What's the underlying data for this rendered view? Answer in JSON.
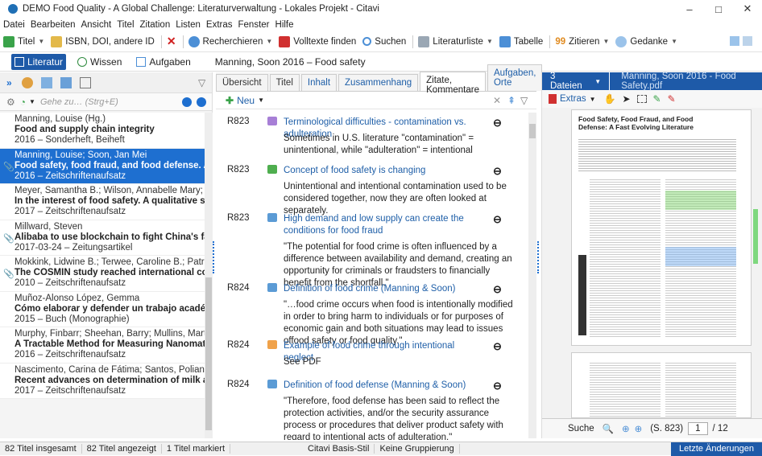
{
  "window": {
    "title": "DEMO Food Quality - A Global Challenge: Literaturverwaltung - Lokales Projekt - Citavi",
    "minimize": "–",
    "maximize": "□",
    "close": "✕"
  },
  "menu": [
    "Datei",
    "Bearbeiten",
    "Ansicht",
    "Titel",
    "Zitation",
    "Listen",
    "Extras",
    "Fenster",
    "Hilfe"
  ],
  "toolbar": {
    "titel": "Titel",
    "isbn": "ISBN, DOI, andere ID",
    "recherchieren": "Recherchieren",
    "volltexte": "Volltexte finden",
    "suchen": "Suchen",
    "literaturliste": "Literaturliste",
    "tabelle": "Tabelle",
    "zitieren": "Zitieren",
    "gedanke": "Gedanke"
  },
  "nav": {
    "tabs": [
      "Literatur",
      "Wissen",
      "Aufgaben"
    ],
    "current_title": "Manning, Soon 2016 – Food safety"
  },
  "left": {
    "search_placeholder": "Gehe zu… (Strg+E)",
    "items": [
      {
        "author": "Manning, Louise (Hg.)",
        "title": "Food and supply chain integrity",
        "year": "2016 – Sonderheft, Beiheft",
        "clip": ""
      },
      {
        "author": "Manning, Louise; Soon, Jan Mei",
        "title": "Food safety, food fraud, and food defense. A fast ev",
        "year": "2016 – Zeitschriftenaufsatz",
        "clip": "📎"
      },
      {
        "author": "Meyer, Samantha B.; Wilson, Annabelle Mary; Calnan",
        "title": "In the interest of food safety. A qualitative study in",
        "year": "2017 – Zeitschriftenaufsatz",
        "clip": ""
      },
      {
        "author": "Millward, Steven",
        "title": "Alibaba to use blockchain to fight China's fake food",
        "year": "2017-03-24 – Zeitungsartikel",
        "clip": "📎"
      },
      {
        "author": "Mokkink, Lidwine B.; Terwee, Caroline B.; Patrick, Do",
        "title": "The COSMIN study reached international consensu",
        "year": "2010 – Zeitschriftenaufsatz",
        "clip": "📎"
      },
      {
        "author": "Muñoz-Alonso López, Gemma",
        "title": "Cómo elaborar y defender un trabajo académico e",
        "year": "2015 – Buch (Monographie)",
        "clip": ""
      },
      {
        "author": "Murphy, Finbarr; Sheehan, Barry; Mullins, Martin; Bo",
        "title": "A Tractable Method for Measuring Nanomaterial Ri",
        "year": "2016 – Zeitschriftenaufsatz",
        "clip": ""
      },
      {
        "author": "Nascimento, Carina de Fátima; Santos, Poliana Mace",
        "title": "Recent advances on determination of milk adultera",
        "year": "2017 – Zeitschriftenaufsatz",
        "clip": ""
      }
    ]
  },
  "center": {
    "tabs": [
      "Übersicht",
      "Titel",
      "Inhalt",
      "Zusammenhang",
      "Zitate, Kommentare",
      "Aufgaben, Orte"
    ],
    "new_label": "Neu",
    "quotes": [
      {
        "num": "R823",
        "title": "Terminological difficulties - contamination vs. adulteration",
        "body": "Sometimes in U.S. literature \"contamination\" = unintentional, while \"adulteration\" = intentional",
        "color": "#a77fd6"
      },
      {
        "num": "R823",
        "title": "Concept of food safety is changing",
        "body": "Unintentional and intentional contamination used to be considered together, now they are often looked at separately.",
        "color": "#4fae4f"
      },
      {
        "num": "R823",
        "title": "High demand and low supply can create the conditions for food fraud",
        "body": "\"The potential for food crime is often influenced by a difference between availability and demand, creating an opportunity for criminals or fraudsters to financially benefit from the shortfall.\"",
        "color": "#5b9bd5"
      },
      {
        "num": "R824",
        "title": "Definition of food crime (Manning & Soon)",
        "body": "\"…food crime occurs when food is intentionally modified in order to bring harm to individuals or for purposes of economic gain and both situations may lead to issues offood safety or food quality.\"",
        "color": "#5b9bd5"
      },
      {
        "num": "R824",
        "title": "Example of food crime through intentional neglect",
        "body": "See PDF",
        "color": "#f0a24a"
      },
      {
        "num": "R824",
        "title": "Definition of food defense (Manning & Soon)",
        "body": "\"Therefore, food defense has been said to reflect the protection activities, and/or the security assurance process or procedures that deliver product safety with regard to intentional acts of adulteration.\"",
        "color": "#5b9bd5"
      }
    ]
  },
  "right": {
    "files_label": "3 Dateien",
    "file_name": "Manning, Soon 2016 - Food Safety.pdf",
    "extras_label": "Extras",
    "pdf_title": "Food Safety, Food Fraud, and Food Defense: A Fast Evolving Literature",
    "search_label": "Suche",
    "page_ref": "(S. 823)",
    "page_current": "1",
    "page_total": "/ 12"
  },
  "status": {
    "total": "82 Titel insgesamt",
    "shown": "82 Titel angezeigt",
    "marked": "1 Titel markiert",
    "style": "Citavi Basis-Stil",
    "grouping": "Keine Gruppierung",
    "changes": "Letzte Änderungen"
  }
}
